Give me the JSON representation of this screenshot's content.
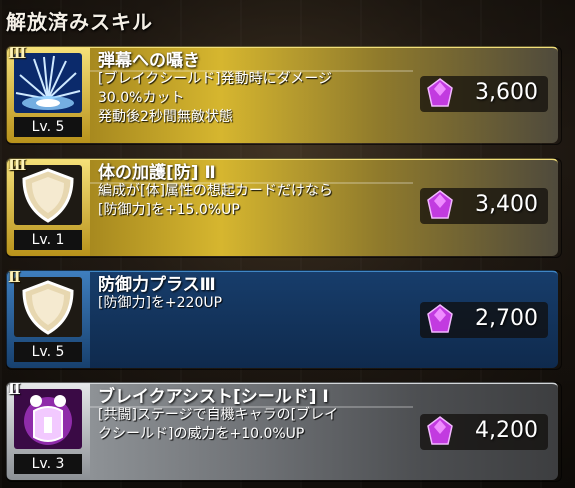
{
  "header": {
    "title": "解放済みスキル"
  },
  "skills": [
    {
      "rank": "Ⅲ",
      "level": "Lv. 5",
      "name": "弾幕への囁き",
      "desc_lines": [
        "[ブレイクシールド]発動時にダメージ",
        "30.0%カット",
        "発動後2秒間無敵状態"
      ],
      "cost": "3,600",
      "icon": "ice-burst-icon",
      "style": "gold"
    },
    {
      "rank": "Ⅲ",
      "level": "Lv. 1",
      "name": "体の加護[防] Ⅱ",
      "desc_lines": [
        "編成が[体]属性の想起カードだけなら",
        "[防御力]を+15.0%UP"
      ],
      "cost": "3,400",
      "icon": "shield-icon",
      "style": "gold"
    },
    {
      "rank": "Ⅱ",
      "level": "Lv. 5",
      "name": "防御力プラスⅢ",
      "desc_lines": [
        "[防御力]を+220UP"
      ],
      "cost": "2,700",
      "icon": "shield-icon",
      "style": "blue"
    },
    {
      "rank": "Ⅱ",
      "level": "Lv. 3",
      "name": "ブレイクアシスト[シールド] Ⅰ",
      "desc_lines": [
        "[共闘]ステージで自機キャラの[ブレイ",
        "クシールド]の威力を+10.0%UP"
      ],
      "cost": "4,200",
      "icon": "break-assist-icon",
      "style": "silver"
    }
  ],
  "colors": {
    "gem": "#c23be0",
    "gold": "#d6b62f",
    "blue": "#0f2a4d",
    "silver": "#6f7276"
  }
}
